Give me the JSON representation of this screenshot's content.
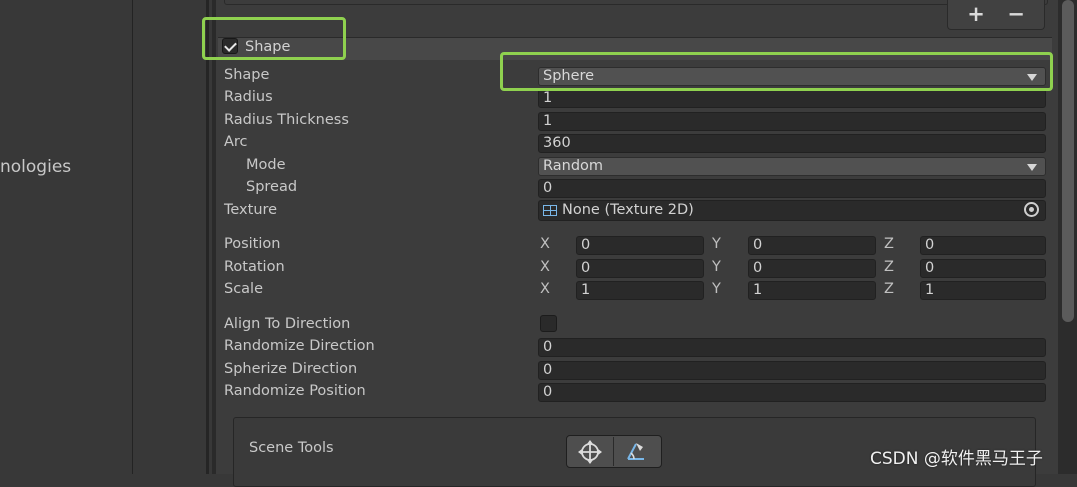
{
  "left_panel": {
    "partial_text": "nologies"
  },
  "list_controls": {
    "add": "+",
    "remove": "−"
  },
  "module": {
    "title": "Shape",
    "enabled": true
  },
  "fields": {
    "shape": {
      "label": "Shape",
      "value": "Sphere"
    },
    "radius": {
      "label": "Radius",
      "value": "1"
    },
    "radius_thickness": {
      "label": "Radius Thickness",
      "value": "1"
    },
    "arc": {
      "label": "Arc",
      "value": "360"
    },
    "mode": {
      "label": "Mode",
      "value": "Random"
    },
    "spread": {
      "label": "Spread",
      "value": "0"
    },
    "texture": {
      "label": "Texture",
      "value": "None (Texture 2D)"
    }
  },
  "axes": {
    "x": "X",
    "y": "Y",
    "z": "Z"
  },
  "transform": {
    "position": {
      "label": "Position",
      "x": "0",
      "y": "0",
      "z": "0"
    },
    "rotation": {
      "label": "Rotation",
      "x": "0",
      "y": "0",
      "z": "0"
    },
    "scale": {
      "label": "Scale",
      "x": "1",
      "y": "1",
      "z": "1"
    }
  },
  "options": {
    "align_to_direction": {
      "label": "Align To Direction",
      "checked": false
    },
    "randomize_direction": {
      "label": "Randomize Direction",
      "value": "0"
    },
    "spherize_direction": {
      "label": "Spherize Direction",
      "value": "0"
    },
    "randomize_position": {
      "label": "Randomize Position",
      "value": "0"
    }
  },
  "scene_tools": {
    "label": "Scene Tools",
    "icons": [
      "move-transform-icon",
      "edit-shape-icon"
    ]
  },
  "watermark": "CSDN @软件黑马王子",
  "colors": {
    "highlight": "#8fd14f",
    "background": "#3c3c3c",
    "field": "#2a2a2a",
    "dropdown": "#515151"
  }
}
